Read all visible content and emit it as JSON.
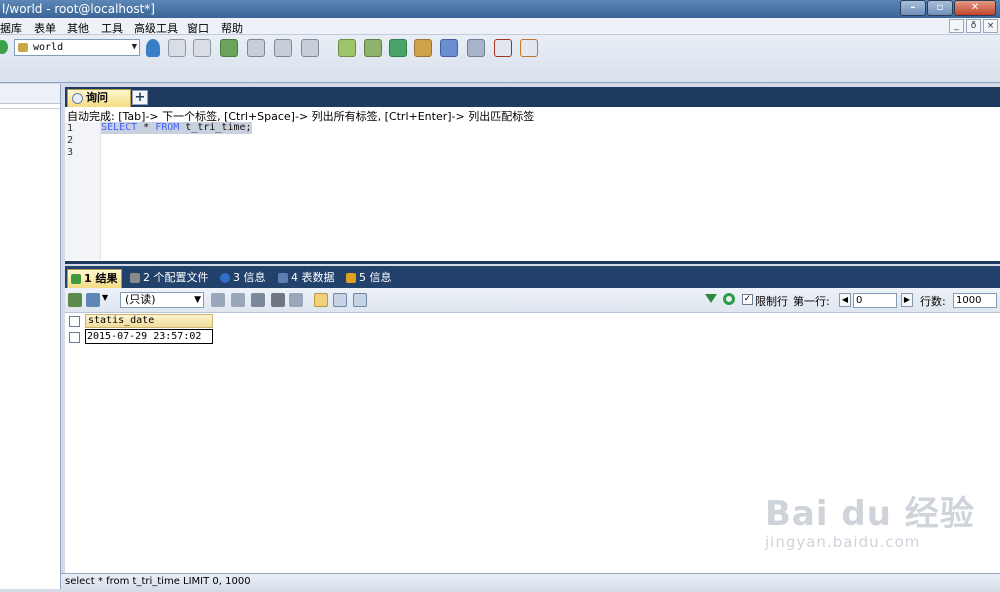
{
  "window": {
    "title": "l/world - root@localhost*]",
    "buttons": {
      "minimize": "–",
      "maximize": "▫",
      "close": "✕"
    }
  },
  "menu": {
    "items": [
      "据库",
      "表单",
      "其他",
      "工具",
      "高级工具",
      "窗口",
      "帮助"
    ],
    "mdi_buttons": [
      "_",
      "ð",
      "×"
    ]
  },
  "toolbar": {
    "database": "world"
  },
  "editor": {
    "tab_label": "询问",
    "add_tab": "+",
    "autocomplete_hint": "自动完成: [Tab]-> 下一个标签, [Ctrl+Space]-> 列出所有标签, [Ctrl+Enter]-> 列出匹配标签",
    "line_numbers": [
      "1",
      "2",
      "3"
    ],
    "sql": {
      "kw1": "SELECT",
      "star": " * ",
      "kw2": "FROM",
      "rest": " t_tri_time;"
    }
  },
  "result_tabs": [
    {
      "label": "1 结果",
      "color": "#3f9a3f"
    },
    {
      "label": "2 个配置文件",
      "color": "#8a8a8a"
    },
    {
      "label": "3 信息",
      "color": "#2e6fc7"
    },
    {
      "label": "4 表数据",
      "color": "#5a7fb0"
    },
    {
      "label": "5 信息",
      "color": "#e0a020"
    }
  ],
  "result_toolbar": {
    "mode": "(只读)",
    "limit_label": "限制行",
    "limit_checked": "✓",
    "first_row_label": "第一行:",
    "first_row_value": "0",
    "rows_label": "行数:",
    "rows_value": "1000",
    "prev": "◀",
    "next": "▶"
  },
  "grid": {
    "columns": [
      "statis_date"
    ],
    "rows": [
      [
        "2015-07-29 23:57:02"
      ]
    ]
  },
  "watermark": {
    "main": "Bai du 经验",
    "sub": "jingyan.baidu.com"
  },
  "status": {
    "text": "select * from t_tri_time LIMIT 0, 1000"
  }
}
